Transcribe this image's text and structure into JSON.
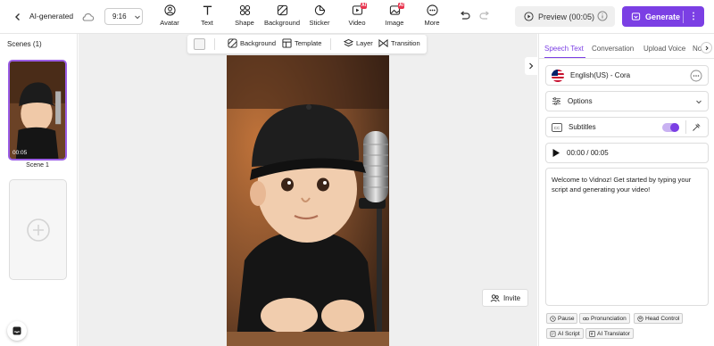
{
  "header": {
    "project_name": "AI-generated",
    "aspect_ratio": "9:16",
    "tools": [
      {
        "label": "Avatar",
        "icon": "avatar-icon"
      },
      {
        "label": "Text",
        "icon": "text-icon"
      },
      {
        "label": "Shape",
        "icon": "shape-icon"
      },
      {
        "label": "Background",
        "icon": "background-icon"
      },
      {
        "label": "Sticker",
        "icon": "sticker-icon"
      },
      {
        "label": "Video",
        "icon": "video-icon",
        "badge": "AI"
      },
      {
        "label": "Image",
        "icon": "image-icon",
        "badge": "AI"
      },
      {
        "label": "More",
        "icon": "more-icon"
      }
    ],
    "preview_label": "Preview (00:05)",
    "generate_label": "Generate",
    "accent_color": "#7b3fe4"
  },
  "scenes": {
    "title": "Scenes (1)",
    "items": [
      {
        "label": "Scene 1",
        "duration": "00:05"
      }
    ]
  },
  "canvas": {
    "toolbar": {
      "background_label": "Background",
      "template_label": "Template",
      "layer_label": "Layer",
      "transition_label": "Transition"
    },
    "invite_label": "Invite"
  },
  "right_panel": {
    "tabs": [
      "Speech Text",
      "Conversation",
      "Upload Voice",
      "No"
    ],
    "active_tab": "Speech Text",
    "voice": "English(US) - Cora",
    "options_label": "Options",
    "subtitles_label": "Subtitles",
    "subtitles_enabled": true,
    "audio_time": "00:00 / 00:05",
    "script_text": "Welcome to Vidnoz! Get started by typing your script and generating your video!",
    "chips": [
      "Pause",
      "Pronunciation",
      "Head Control",
      "AI Script",
      "AI Translator"
    ]
  }
}
